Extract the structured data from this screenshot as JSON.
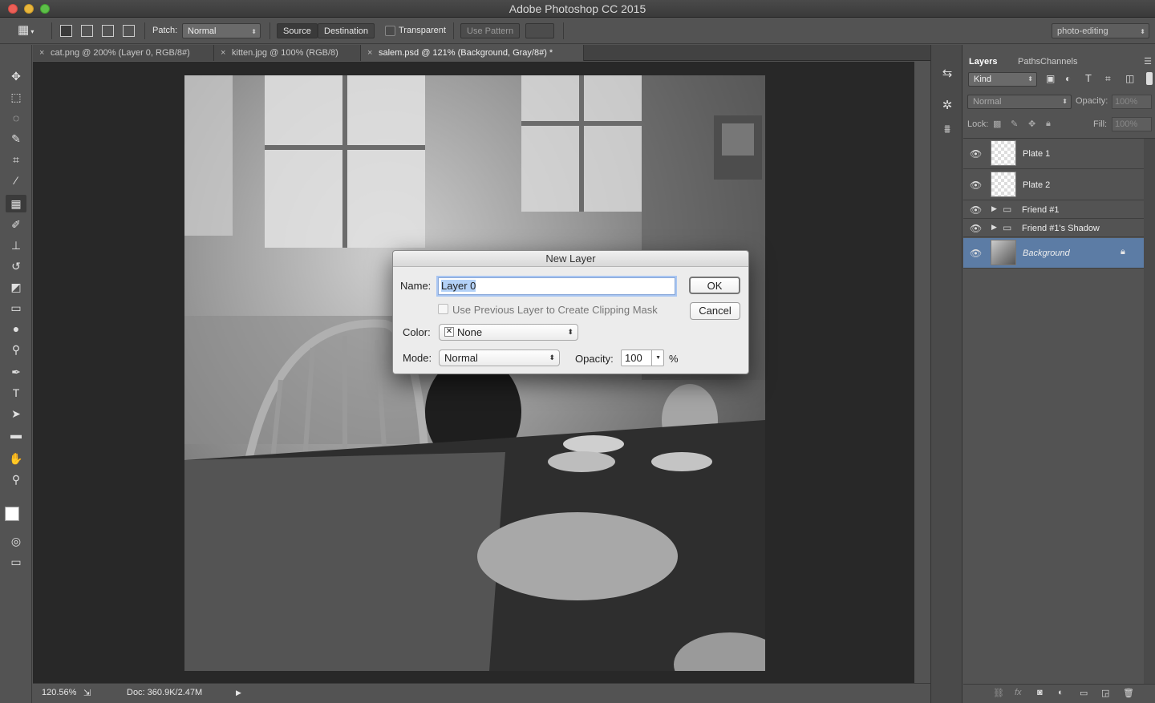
{
  "window": {
    "title": "Adobe Photoshop CC 2015"
  },
  "options": {
    "patch_label": "Patch:",
    "patch_mode": "Normal",
    "source_btn": "Source",
    "destination_btn": "Destination",
    "transparent_label": "Transparent",
    "use_pattern_btn": "Use Pattern",
    "workspace": "photo-editing"
  },
  "tabs": [
    {
      "label": "cat.png @ 200% (Layer 0, RGB/8#)",
      "active": false
    },
    {
      "label": "kitten.jpg @ 100% (RGB/8)",
      "active": false
    },
    {
      "label": "salem.psd @ 121% (Background, Gray/8#) *",
      "active": true
    }
  ],
  "status": {
    "zoom": "120.56%",
    "doc": "Doc: 360.9K/2.47M"
  },
  "layers_panel": {
    "tabs": [
      "Layers",
      "Paths",
      "Channels"
    ],
    "filter_kind": "Kind",
    "blend_mode": "Normal",
    "opacity_label": "Opacity:",
    "opacity_value": "100%",
    "lock_label": "Lock:",
    "fill_label": "Fill:",
    "fill_value": "100%",
    "layers": [
      {
        "name": "Plate 1",
        "type": "layer"
      },
      {
        "name": "Plate 2",
        "type": "layer"
      },
      {
        "name": "Friend #1",
        "type": "group"
      },
      {
        "name": "Friend #1's Shadow",
        "type": "group"
      },
      {
        "name": "Background",
        "type": "background",
        "selected": true,
        "locked": true
      }
    ]
  },
  "dialog": {
    "title": "New Layer",
    "name_label": "Name:",
    "name_value": "Layer 0",
    "clip_label": "Use Previous Layer to Create Clipping Mask",
    "color_label": "Color:",
    "color_value": "None",
    "mode_label": "Mode:",
    "mode_value": "Normal",
    "opacity_label": "Opacity:",
    "opacity_value": "100",
    "opacity_unit": "%",
    "ok": "OK",
    "cancel": "Cancel"
  },
  "colors": {
    "selection": "#5c7ca5",
    "panel_bg": "#535353",
    "canvas_bg": "#282828"
  }
}
